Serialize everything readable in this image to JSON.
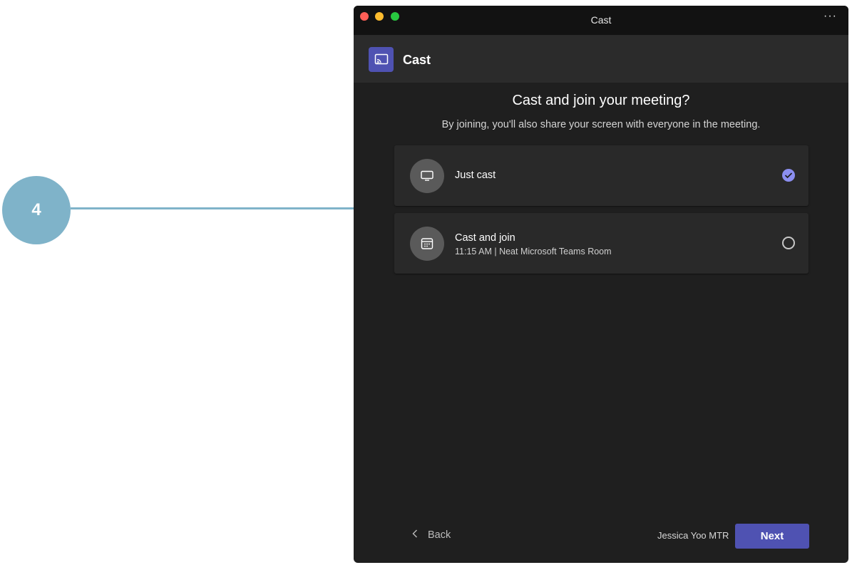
{
  "callout": {
    "step_number": "4",
    "color": "#7fb3c9"
  },
  "window": {
    "title": "Cast",
    "more_label": "···"
  },
  "app_header": {
    "icon": "cast-icon",
    "title": "Cast",
    "accent_color": "#4f52b2"
  },
  "dialog": {
    "heading": "Cast and join your meeting?",
    "subheading": "By joining, you'll also share your screen with everyone in the meeting."
  },
  "options": [
    {
      "icon": "monitor-icon",
      "label": "Just cast",
      "selected": true
    },
    {
      "icon": "calendar-icon",
      "label": "Cast and join",
      "detail": "11:15 AM | Neat Microsoft Teams Room",
      "selected": false
    }
  ],
  "footer": {
    "back_label": "Back",
    "user_name": "Jessica Yoo MTR",
    "next_label": "Next"
  }
}
